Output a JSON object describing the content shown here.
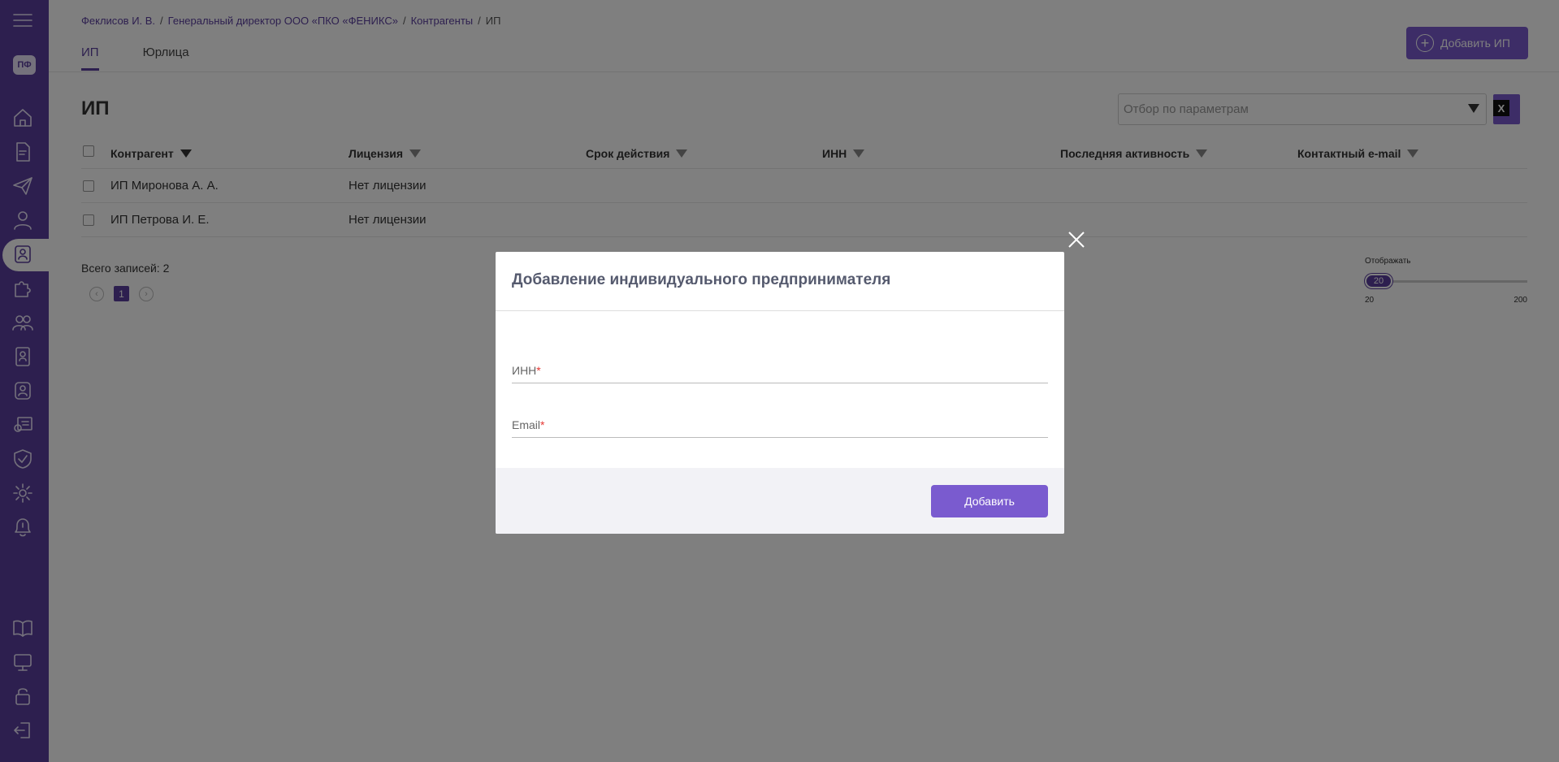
{
  "sidebar": {
    "badge": "ПФ",
    "icons": [
      "menu-icon",
      "home-icon",
      "document-icon",
      "paper-plane-icon",
      "user-icon",
      "contractor-icon",
      "puzzle-icon",
      "users-group-icon",
      "contact-card-icon",
      "user-badge-icon",
      "certificate-icon",
      "shield-check-icon",
      "gear-icon",
      "bell-icon",
      "book-icon",
      "monitor-icon",
      "lock-icon",
      "logout-icon"
    ]
  },
  "breadcrumb": {
    "items": [
      "Феклисов И. В.",
      "Генеральный директор ООО «ПКО «ФЕНИКС»",
      "Контрагенты"
    ],
    "current": "ИП",
    "separator": "/"
  },
  "tabs": [
    {
      "label": "ИП",
      "active": true
    },
    {
      "label": "Юрлица",
      "active": false
    }
  ],
  "header": {
    "add_button": "Добавить ИП",
    "page_title": "ИП"
  },
  "filter": {
    "placeholder": "Отбор по параметрам"
  },
  "excel": {
    "label": "X"
  },
  "table": {
    "columns": [
      "Контрагент",
      "Лицензия",
      "Срок действия",
      "ИНН",
      "Последняя активность",
      "Контактный e-mail"
    ],
    "rows": [
      {
        "name": "ИП Миронова А. А.",
        "license": "Нет лицензии"
      },
      {
        "name": "ИП Петрова И. Е.",
        "license": "Нет лицензии"
      }
    ]
  },
  "footer": {
    "total": "Всего записей: 2",
    "page": "1",
    "per_page_label": "Отображать",
    "per_page_value": "20",
    "per_page_min": "20",
    "per_page_max": "200"
  },
  "modal": {
    "title": "Добавление индивидуального предпринимателя",
    "inn_label": "ИНН",
    "email_label": "Email",
    "required_mark": "*",
    "submit": "Добавить"
  },
  "colors": {
    "brand": "#5b3f9e",
    "accent": "#7a5bcf"
  }
}
